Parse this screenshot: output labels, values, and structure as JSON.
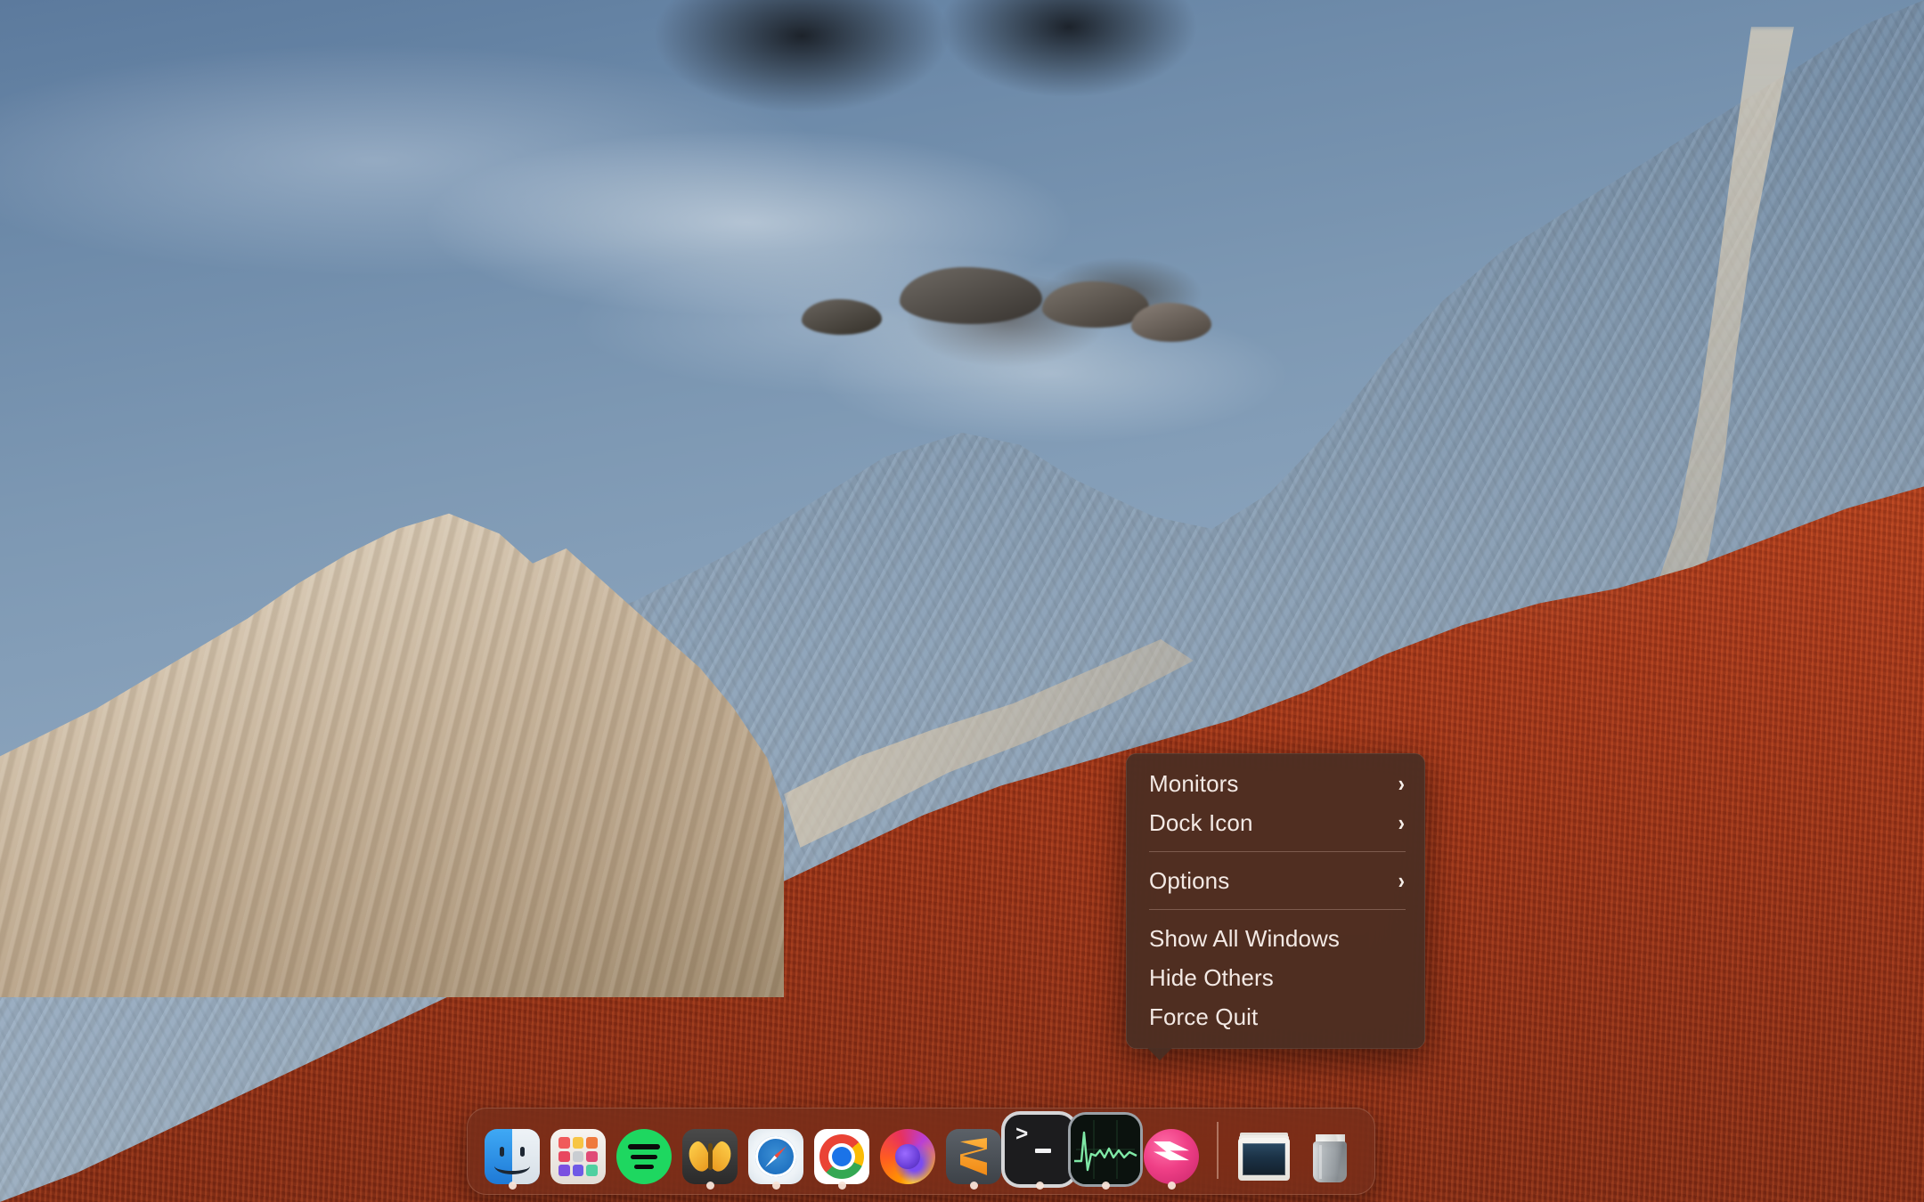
{
  "desktop": {
    "wallpaper_name": "big-sur-coastline",
    "colors": {
      "water": "#7d98b2",
      "rock": "#d4c4ad",
      "iceplant": "#9c3418",
      "menu_background": "#482e24",
      "menu_text": "#f3e9e4",
      "dock_background": "#6a2f1e"
    }
  },
  "context_menu": {
    "owner": "Terminal",
    "groups": [
      {
        "items": [
          {
            "label": "Monitors",
            "has_submenu": true,
            "icon": "chevron-right-icon",
            "arrow": "›"
          },
          {
            "label": "Dock Icon",
            "has_submenu": true,
            "icon": "chevron-right-icon",
            "arrow": "›"
          }
        ]
      },
      {
        "items": [
          {
            "label": "Options",
            "has_submenu": true,
            "icon": "chevron-right-icon",
            "arrow": "›"
          }
        ]
      },
      {
        "items": [
          {
            "label": "Show All Windows",
            "has_submenu": false,
            "arrow": ""
          },
          {
            "label": "Hide Others",
            "has_submenu": false,
            "arrow": ""
          },
          {
            "label": "Force Quit",
            "has_submenu": false,
            "arrow": ""
          }
        ]
      }
    ]
  },
  "dock": {
    "apps": [
      {
        "name": "Finder",
        "icon": "finder-icon",
        "running": true,
        "magnified": false
      },
      {
        "name": "Launchpad",
        "icon": "launchpad-icon",
        "running": false,
        "magnified": false
      },
      {
        "name": "Spotify",
        "icon": "spotify-icon",
        "running": false,
        "magnified": false
      },
      {
        "name": "Emacs",
        "icon": "emacs-icon",
        "running": true,
        "magnified": false
      },
      {
        "name": "Safari",
        "icon": "safari-icon",
        "running": true,
        "magnified": false
      },
      {
        "name": "Google Chrome",
        "icon": "chrome-icon",
        "running": true,
        "magnified": false
      },
      {
        "name": "Firefox",
        "icon": "firefox-icon",
        "running": false,
        "magnified": false
      },
      {
        "name": "Sublime Text",
        "icon": "sublime-text-icon",
        "running": true,
        "magnified": false
      },
      {
        "name": "Terminal",
        "icon": "terminal-icon",
        "running": true,
        "magnified": true
      },
      {
        "name": "Activity Monitor",
        "icon": "activity-monitor-icon",
        "running": true,
        "magnified": true
      },
      {
        "name": "Skitch",
        "icon": "skitch-icon",
        "running": true,
        "magnified": false
      }
    ],
    "others": [
      {
        "name": "Screenshots Stack",
        "icon": "stack-icon"
      },
      {
        "name": "Trash",
        "icon": "trash-icon"
      }
    ],
    "terminal_prompt_glyph": ">"
  },
  "launchpad_tiles": [
    "#f05a5a",
    "#f7c544",
    "#ef7a3d",
    "#e8485f",
    "#c9cdd2",
    "#e04a76",
    "#7a50e0",
    "#6f5ae6",
    "#4fd0a0"
  ]
}
